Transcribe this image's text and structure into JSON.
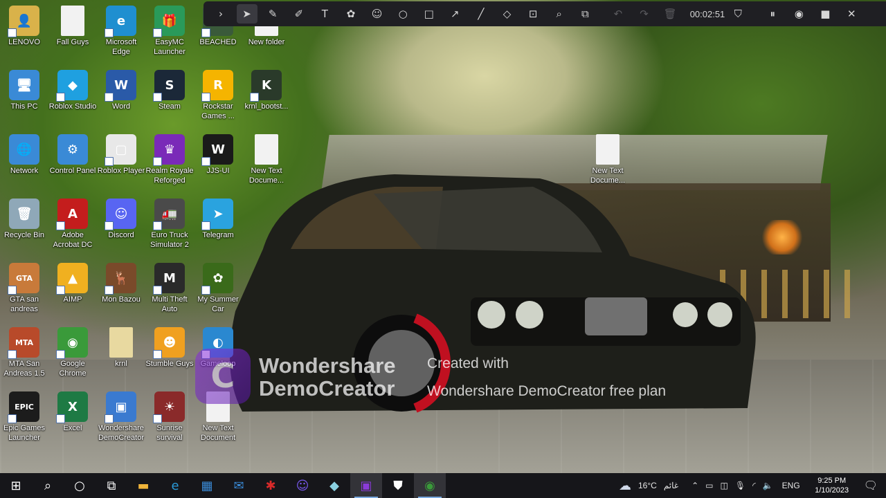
{
  "desktop": {
    "icons": [
      {
        "label": "LENOVO",
        "color": "#d9b24a",
        "glyph": "👤"
      },
      {
        "label": "This PC",
        "color": "#3a8ad6",
        "glyph": "🖥"
      },
      {
        "label": "Network",
        "color": "#3a8ad6",
        "glyph": "🌐"
      },
      {
        "label": "Recycle Bin",
        "color": "#8fa8b8",
        "glyph": "🗑"
      },
      {
        "label": "GTA san andreas",
        "color": "#c87a3a",
        "glyph": "GTA"
      },
      {
        "label": "MTA San Andreas 1.5",
        "color": "#b84a2a",
        "glyph": "MTA"
      },
      {
        "label": "Epic Games Launcher",
        "color": "#1c1c1c",
        "glyph": "EPIC"
      },
      {
        "label": "Fall Guys",
        "color": "#f2f2f2",
        "glyph": ""
      },
      {
        "label": "Roblox Studio",
        "color": "#1fa0e0",
        "glyph": "◆"
      },
      {
        "label": "Control Panel",
        "color": "#3a8ad6",
        "glyph": "⚙"
      },
      {
        "label": "Adobe Acrobat DC",
        "color": "#c41d1d",
        "glyph": "A"
      },
      {
        "label": "AIMP",
        "color": "#f0b020",
        "glyph": "▲"
      },
      {
        "label": "Google Chrome",
        "color": "#3a9a3a",
        "glyph": "◉"
      },
      {
        "label": "Excel",
        "color": "#1e7a44",
        "glyph": "X"
      },
      {
        "label": "Microsoft Edge",
        "color": "#1f8fd0",
        "glyph": "e"
      },
      {
        "label": "Word",
        "color": "#2a5aa8",
        "glyph": "W"
      },
      {
        "label": "Roblox Player",
        "color": "#e8e8e8",
        "glyph": "▢"
      },
      {
        "label": "Discord",
        "color": "#5865f2",
        "glyph": "☺"
      },
      {
        "label": "Mon Bazou",
        "color": "#7a4a2a",
        "glyph": "🦌"
      },
      {
        "label": "krnl",
        "color": "#e8d9a0",
        "glyph": ""
      },
      {
        "label": "Wondershare DemoCreator",
        "color": "#3a7ad0",
        "glyph": "▣"
      },
      {
        "label": "EasyMC Launcher",
        "color": "#2a9a5a",
        "glyph": "🎁"
      },
      {
        "label": "Steam",
        "color": "#1b2838",
        "glyph": "S"
      },
      {
        "label": "Realm Royale Reforged",
        "color": "#7a2ab8",
        "glyph": "♛"
      },
      {
        "label": "Euro Truck Simulator 2",
        "color": "#4a4a4a",
        "glyph": "🚛"
      },
      {
        "label": "Multi Theft Auto",
        "color": "#2a2a2a",
        "glyph": "M"
      },
      {
        "label": "Stumble Guys",
        "color": "#f0a020",
        "glyph": "☻"
      },
      {
        "label": "Sunrise survival",
        "color": "#8a2a2a",
        "glyph": "☀"
      },
      {
        "label": "BEACHED",
        "color": "#3a5a3a",
        "glyph": ""
      },
      {
        "label": "Rockstar Games ...",
        "color": "#f5b400",
        "glyph": "R"
      },
      {
        "label": "JJS-UI",
        "color": "#1a1a1a",
        "glyph": "W"
      },
      {
        "label": "Telegram",
        "color": "#2aa3df",
        "glyph": "➤"
      },
      {
        "label": "My Summer Car",
        "color": "#3a6a1a",
        "glyph": "✿"
      },
      {
        "label": "Gameloop",
        "color": "#2a88d0",
        "glyph": "◐"
      },
      {
        "label": "New Text Document",
        "color": "#f2f2f2",
        "glyph": ""
      },
      {
        "label": "New folder",
        "color": "#f2f2f2",
        "glyph": ""
      },
      {
        "label": "krnl_bootst...",
        "color": "#2a3a2a",
        "glyph": "K"
      },
      {
        "label": "New Text Docume...",
        "color": "#f2f2f2",
        "glyph": ""
      },
      {
        "label": "New Text Docume...",
        "color": "#f2f2f2",
        "glyph": ""
      }
    ]
  },
  "recorder": {
    "timer": "00:02:51",
    "tools": [
      "expand",
      "select",
      "pen",
      "highlighter",
      "text",
      "stamp",
      "emoji",
      "circle",
      "rectangle",
      "arrow",
      "line",
      "eraser",
      "spotlight",
      "magnifier",
      "whiteboard"
    ],
    "tool_icons": [
      "›",
      "➤",
      "✎",
      "✐",
      "T",
      "✿",
      "☺",
      "○",
      "□",
      "↗",
      "╱",
      "◇",
      "⊡",
      "⌕",
      "⧉"
    ],
    "history_icons": [
      "↶",
      "↷",
      "🗑"
    ],
    "control_icons": [
      "⏸",
      "◉",
      "■",
      "✕"
    ]
  },
  "watermark": {
    "brand_line1": "Wondershare",
    "brand_line2": "DemoCreator",
    "created": "Created with",
    "plan": "Wondershare DemoCreator free plan"
  },
  "taskbar": {
    "apps": [
      {
        "name": "start-button",
        "glyph": "⊞",
        "color": "#ffffff"
      },
      {
        "name": "search-icon",
        "glyph": "⌕",
        "color": "#ffffff"
      },
      {
        "name": "cortana-icon",
        "glyph": "○",
        "color": "#ffffff"
      },
      {
        "name": "task-view-icon",
        "glyph": "⧉",
        "color": "#ffffff"
      },
      {
        "name": "file-explorer-icon",
        "glyph": "▬",
        "color": "#f0b43a"
      },
      {
        "name": "edge-icon",
        "glyph": "e",
        "color": "#2a9ad8"
      },
      {
        "name": "store-icon",
        "glyph": "▦",
        "color": "#3a8ad6"
      },
      {
        "name": "mail-icon",
        "glyph": "✉",
        "color": "#3a8ad6"
      },
      {
        "name": "roblox-studio-icon",
        "glyph": "✱",
        "color": "#d82a2a"
      },
      {
        "name": "discord-icon",
        "glyph": "☺",
        "color": "#7a5af2"
      },
      {
        "name": "notepad-icon",
        "glyph": "◆",
        "color": "#8ad0e0"
      },
      {
        "name": "democreator-icon",
        "glyph": "▣",
        "color": "#8a3ad8"
      },
      {
        "name": "security-icon",
        "glyph": "⛊",
        "color": "#ffffff"
      },
      {
        "name": "chrome-icon",
        "glyph": "◉",
        "color": "#3a9a3a"
      }
    ]
  },
  "tray": {
    "weather_icon": "☁",
    "temperature": "16°C",
    "weather_text": "غائم",
    "language": "ENG",
    "time": "9:25 PM",
    "date": "1/10/2023"
  }
}
